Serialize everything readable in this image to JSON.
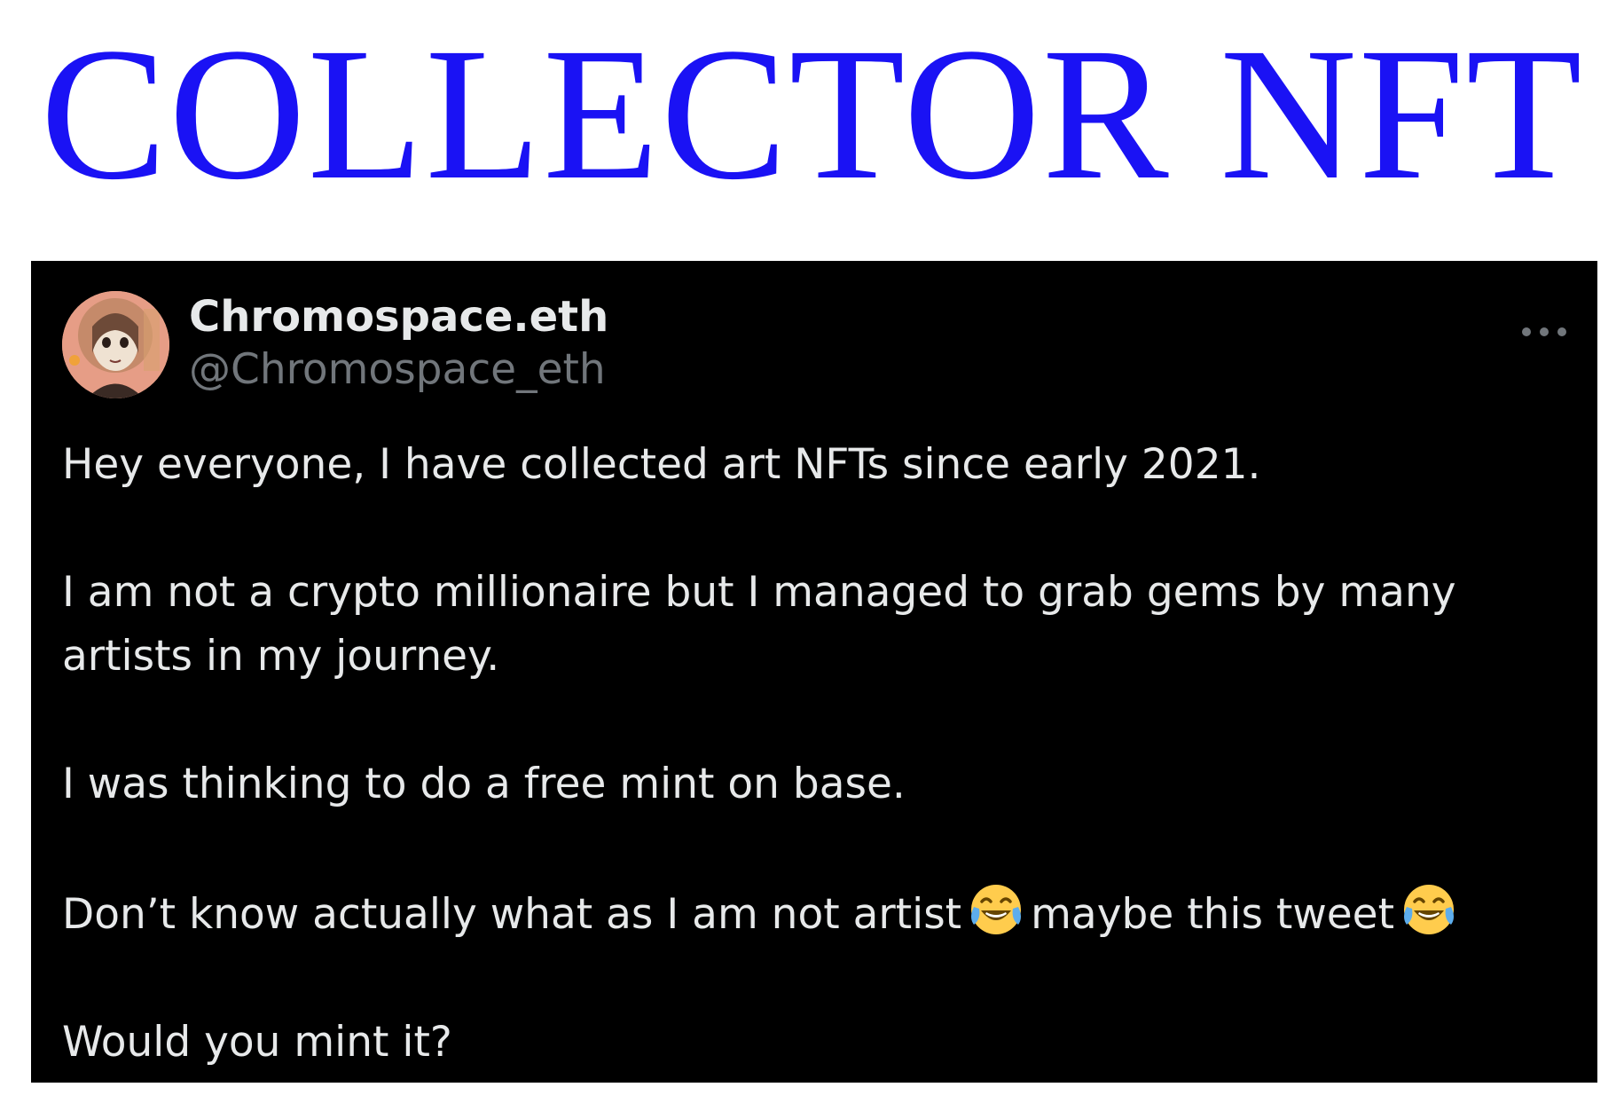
{
  "banner": {
    "title": "COLLECTOR NFT",
    "color": "#1a12f4"
  },
  "tweet": {
    "avatar_icon": "avatar-portrait-icon",
    "display_name": "Chromospace.eth",
    "handle": "@Chromospace_eth",
    "more_icon": "more-dots-icon",
    "paragraphs": [
      "Hey everyone, I have collected art NFTs since early 2021.",
      "I am not a crypto millionaire but I managed to grab gems by many",
      "artists in my journey.",
      "I was thinking to do a free mint on base.",
      "Don’t know actually what as I am not artist",
      "maybe this tweet",
      "Would you mint it?"
    ],
    "emoji": "face-with-tears-of-joy-icon",
    "colors": {
      "background": "#000000",
      "text": "#e7e9ea",
      "secondary_text": "#71767b"
    }
  }
}
